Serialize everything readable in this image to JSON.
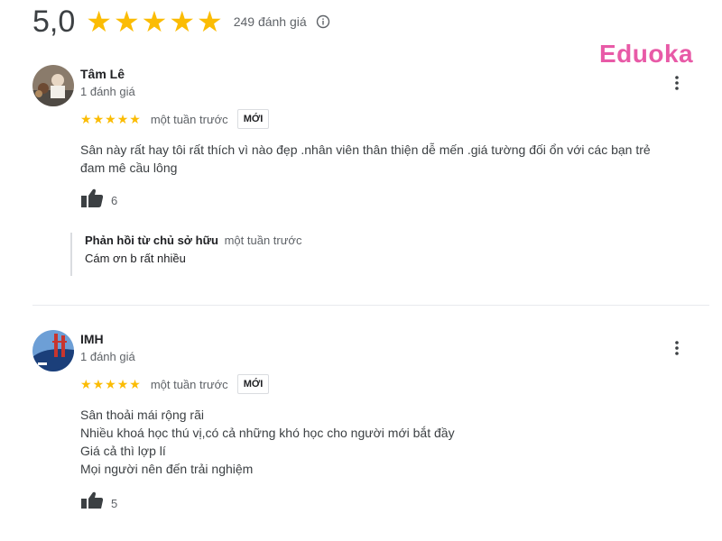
{
  "header": {
    "score": "5,0",
    "stars": 5,
    "total_reviews": "249 đánh giá"
  },
  "watermark": {
    "text": "Eduoka",
    "color": "#e85aa7"
  },
  "colors": {
    "star": "#fbbc04",
    "muted": "#5f6368",
    "text": "#202124"
  },
  "reviews": [
    {
      "author": "Tâm Lê",
      "meta": "1 đánh giá",
      "stars": 5,
      "time": "một tuần trước",
      "badge": "MỚI",
      "text_lines": [
        "Sân này rất hay tôi rất thích vì nào đẹp .nhân viên thân thiện dễ mến .giá tường đối ổn với các bạn trẻ",
        "đam mê cầu lông"
      ],
      "likes": "6",
      "owner_reply": {
        "title": "Phản hồi từ chủ sở hữu",
        "time": "một tuần trước",
        "text": "Cám ơn b rất nhiều"
      }
    },
    {
      "author": "IMH",
      "meta": "1 đánh giá",
      "stars": 5,
      "time": "một tuần trước",
      "badge": "MỚI",
      "text_lines": [
        "Sân thoải mái rộng rãi",
        "Nhiều khoá học thú vị,có cả những khó học cho người mới bắt đầy",
        "Giá cả thì lợp lí",
        "Mọi người nên đến trải nghiệm"
      ],
      "likes": "5"
    }
  ],
  "icons": {
    "info": "info-icon",
    "more": "more-vert-icon",
    "like": "thumbs-up-icon",
    "star": "star-icon"
  }
}
